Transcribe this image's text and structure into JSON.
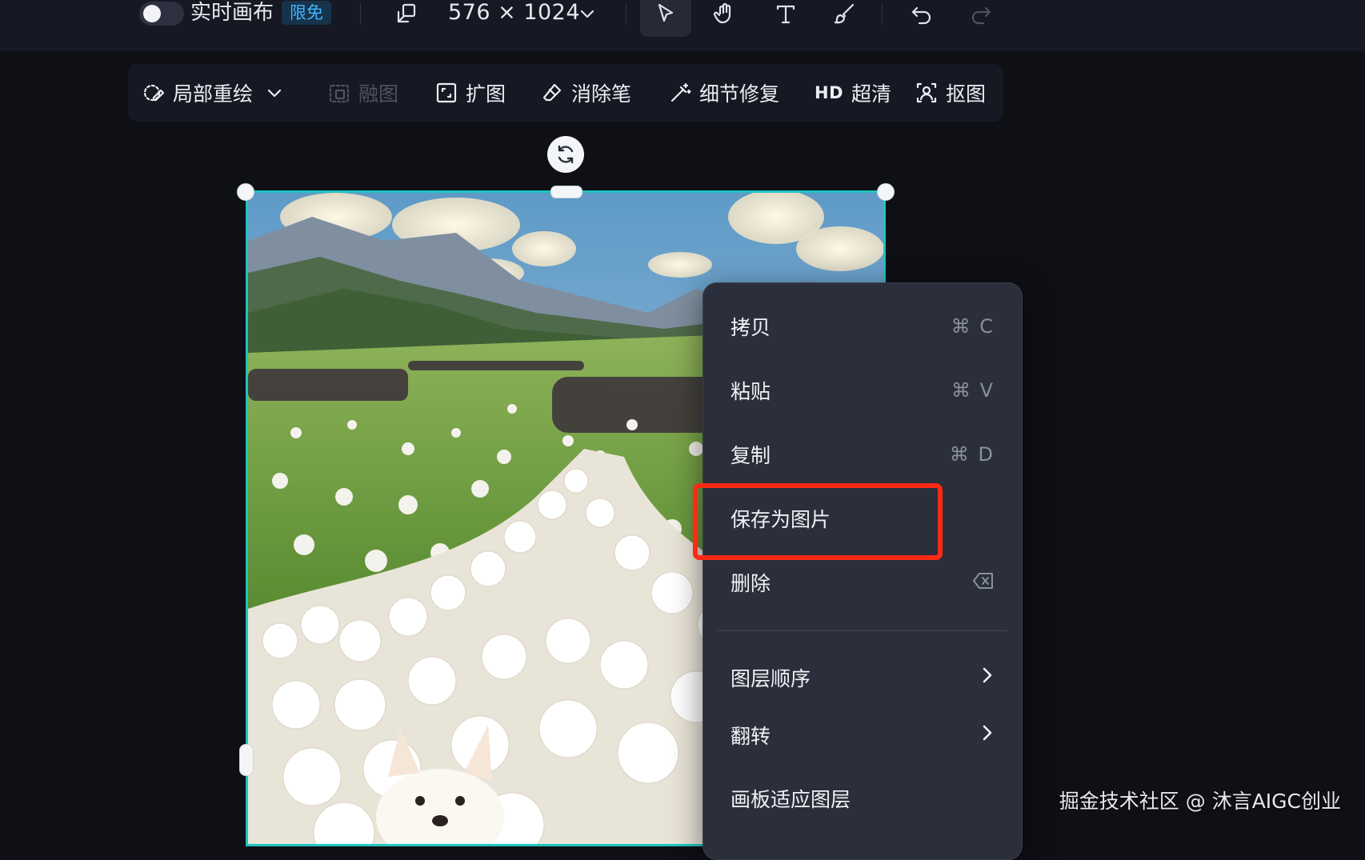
{
  "topbar": {
    "realtime_canvas_label": "实时画布",
    "free_badge": "限免",
    "canvas_size": "576 × 1024",
    "tools": [
      "resize-icon",
      "select-cursor-icon",
      "hand-icon",
      "text-icon",
      "brush-icon",
      "undo-icon",
      "redo-icon"
    ]
  },
  "toolbar2": {
    "inpaint": "局部重绘",
    "blend": "融图",
    "expand": "扩图",
    "eraser": "消除笔",
    "detail_fix": "细节修复",
    "hd_mark": "HD",
    "upscale": "超清",
    "cutout": "抠图"
  },
  "context_menu": {
    "items": [
      {
        "label": "拷贝",
        "shortcut": "⌘ C"
      },
      {
        "label": "粘贴",
        "shortcut": "⌘ V"
      },
      {
        "label": "复制",
        "shortcut": "⌘ D"
      },
      {
        "label": "保存为图片",
        "shortcut": ""
      },
      {
        "label": "删除",
        "shortcut": ""
      },
      {
        "label": "图层顺序",
        "shortcut": ""
      },
      {
        "label": "翻转",
        "shortcut": ""
      },
      {
        "label": "画板适应图层",
        "shortcut": ""
      }
    ]
  },
  "colors": {
    "accent_frame": "#1fc4bf",
    "highlight": "#ff2a14",
    "badge_text": "#3fb6ff"
  },
  "watermark": "掘金技术社区 @ 沐言AIGC创业"
}
